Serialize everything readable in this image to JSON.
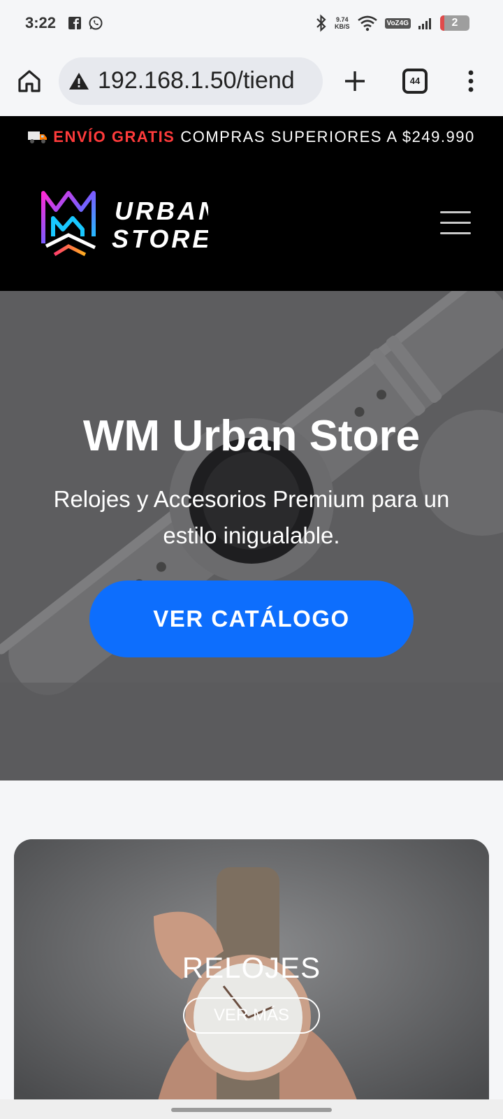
{
  "status_bar": {
    "time": "3:22",
    "net_speed_value": "9.74",
    "net_speed_unit": "KB/S",
    "volte_label": "VoZ4G",
    "battery_level": "2",
    "icons": [
      "facebook-icon",
      "whatsapp-icon",
      "bluetooth-icon",
      "wifi-icon",
      "signal-icon",
      "battery-icon"
    ]
  },
  "browser": {
    "url": "192.168.1.50/tiend",
    "tab_count": "44",
    "icons": [
      "home-icon",
      "warning-icon",
      "plus-icon",
      "tabs-icon",
      "more-vert-icon"
    ]
  },
  "promo": {
    "highlight": "ENVÍO GRATIS",
    "text": "COMPRAS SUPERIORES A $249.990",
    "highlight_color": "#ff3b3b",
    "icon": "truck-icon"
  },
  "header": {
    "logo_line1": "URBAN",
    "logo_line2": "STORE",
    "menu_icon": "hamburger-menu-icon"
  },
  "hero": {
    "title": "WM Urban Store",
    "subtitle": "Relojes y Accesorios Premium para un estilo inigualable.",
    "cta_label": "VER CATÁLOGO",
    "cta_color": "#0d6efd"
  },
  "category": {
    "title": "RELOJES",
    "button_label": "VER MÁS"
  }
}
